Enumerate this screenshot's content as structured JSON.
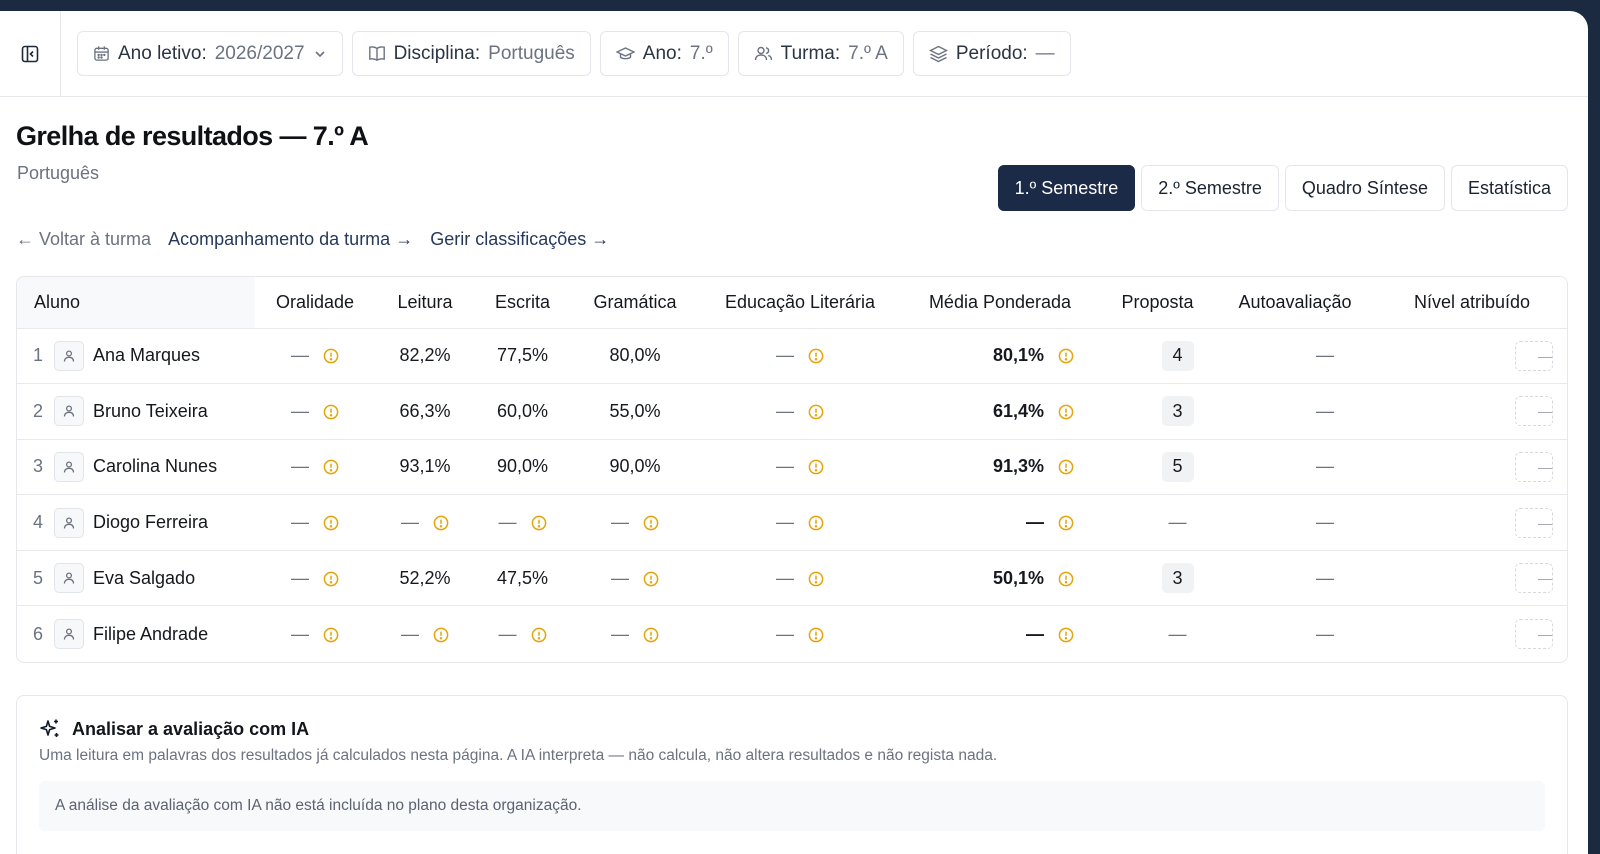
{
  "filters": [
    {
      "label": "Ano letivo:",
      "value": "2026/2027",
      "icon": "calendar-icon",
      "dropdown": true
    },
    {
      "label": "Disciplina:",
      "value": "Português",
      "icon": "book-icon"
    },
    {
      "label": "Ano:",
      "value": "7.º",
      "icon": "graduation-cap-icon"
    },
    {
      "label": "Turma:",
      "value": "7.º A",
      "icon": "users-icon"
    },
    {
      "label": "Período:",
      "value": "—",
      "icon": "layers-icon"
    }
  ],
  "page": {
    "title": "Grelha de resultados — 7.º A",
    "subtitle": "Português"
  },
  "tabs": [
    {
      "label": "1.º Semestre",
      "active": true
    },
    {
      "label": "2.º Semestre",
      "active": false
    },
    {
      "label": "Quadro Síntese",
      "active": false
    },
    {
      "label": "Estatística",
      "active": false
    }
  ],
  "links": {
    "back": "← Voltar à turma",
    "follow": "Acompanhamento da turma →",
    "manage": "Gerir classificações →"
  },
  "table": {
    "headers": [
      "Aluno",
      "Oralidade",
      "Leitura",
      "Escrita",
      "Gramática",
      "Educação Literária",
      "Média Ponderada",
      "Proposta",
      "Autoavaliação",
      "Nível atribuído"
    ],
    "rows": [
      {
        "num": "1",
        "name": "Ana Marques",
        "oralidade": "—",
        "leitura": "82,2%",
        "escrita": "77,5%",
        "gramatica": "80,0%",
        "educacao": "—",
        "media": "80,1%",
        "proposta": "4",
        "auto": "—",
        "nivel": "—"
      },
      {
        "num": "2",
        "name": "Bruno Teixeira",
        "oralidade": "—",
        "leitura": "66,3%",
        "escrita": "60,0%",
        "gramatica": "55,0%",
        "educacao": "—",
        "media": "61,4%",
        "proposta": "3",
        "auto": "—",
        "nivel": "—"
      },
      {
        "num": "3",
        "name": "Carolina Nunes",
        "oralidade": "—",
        "leitura": "93,1%",
        "escrita": "90,0%",
        "gramatica": "90,0%",
        "educacao": "—",
        "media": "91,3%",
        "proposta": "5",
        "auto": "—",
        "nivel": "—"
      },
      {
        "num": "4",
        "name": "Diogo Ferreira",
        "oralidade": "—",
        "leitura": "—",
        "escrita": "—",
        "gramatica": "—",
        "educacao": "—",
        "media": "—",
        "proposta": "—",
        "auto": "—",
        "nivel": "—"
      },
      {
        "num": "5",
        "name": "Eva Salgado",
        "oralidade": "—",
        "leitura": "52,2%",
        "escrita": "47,5%",
        "gramatica": "—",
        "educacao": "—",
        "media": "50,1%",
        "proposta": "3",
        "auto": "—",
        "nivel": "—"
      },
      {
        "num": "6",
        "name": "Filipe Andrade",
        "oralidade": "—",
        "leitura": "—",
        "escrita": "—",
        "gramatica": "—",
        "educacao": "—",
        "media": "—",
        "proposta": "—",
        "auto": "—",
        "nivel": "—"
      }
    ]
  },
  "ai": {
    "title": "Analisar a avaliação com IA",
    "description": "Uma leitura em palavras dos resultados já calculados nesta página. A IA interpreta — não calcula, não altera resultados e não regista nada.",
    "notice": "A análise da avaliação com IA não está incluída no plano desta organização."
  },
  "colors": {
    "accent": "#1b2a47",
    "warning": "#e5a50a",
    "frame": "#1b2a40"
  }
}
